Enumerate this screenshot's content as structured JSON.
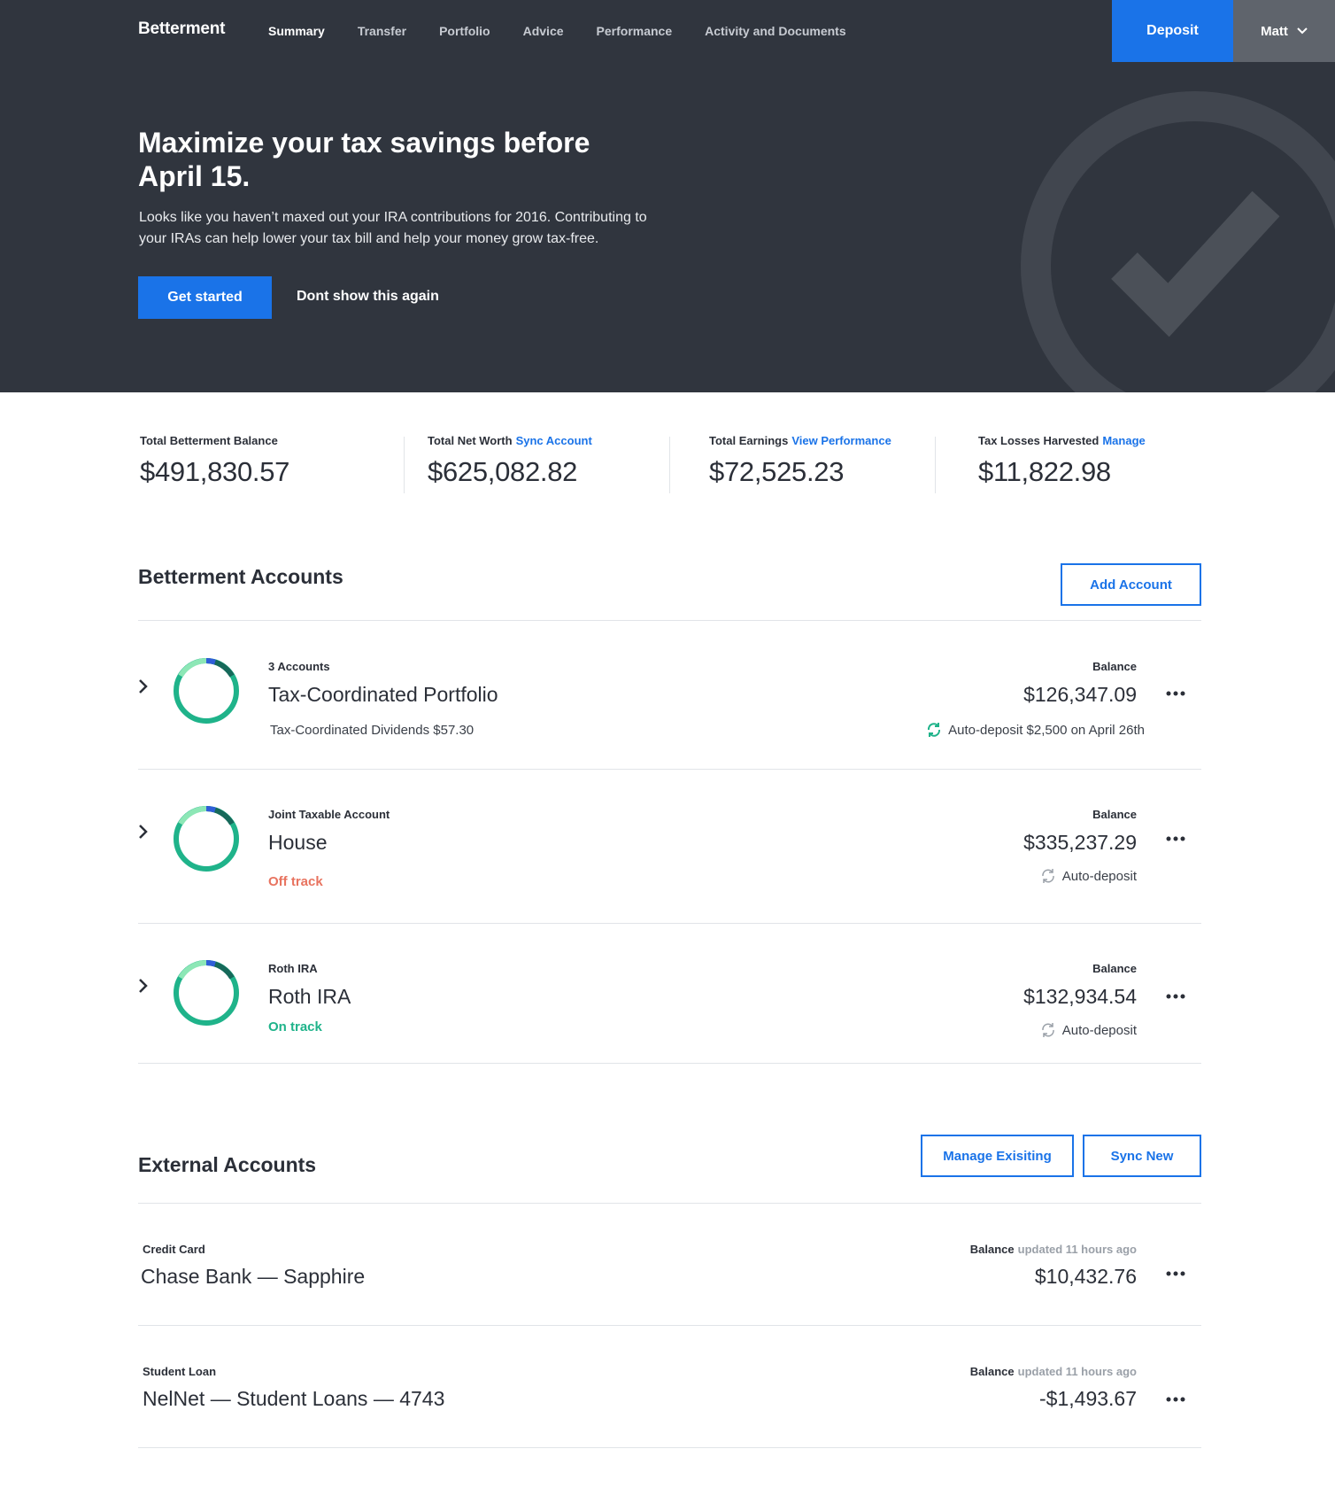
{
  "nav": {
    "brand": "Betterment",
    "links": [
      "Summary",
      "Transfer",
      "Portfolio",
      "Advice",
      "Performance",
      "Activity and Documents"
    ],
    "deposit_label": "Deposit",
    "user_name": "Matt"
  },
  "hero": {
    "title": "Maximize your tax savings before April 15.",
    "body": "Looks like you haven’t maxed out your IRA contributions for 2016. Contributing to your IRAs can help lower your tax bill and help your money grow tax-free.",
    "cta_label": "Get started",
    "dismiss_label": "Dont show this again"
  },
  "stats": [
    {
      "label": "Total Betterment Balance",
      "link": "",
      "value": "$491,830.57"
    },
    {
      "label": "Total Net Worth",
      "link": "Sync Account",
      "value": "$625,082.82"
    },
    {
      "label": "Total Earnings",
      "link": "View Performance",
      "value": "$72,525.23"
    },
    {
      "label": "Tax Losses Harvested",
      "link": "Manage",
      "value": "$11,822.98"
    }
  ],
  "betterment_accounts": {
    "title": "Betterment Accounts",
    "add_label": "Add Account",
    "items": [
      {
        "type": "3 Accounts",
        "name": "Tax-Coordinated Portfolio",
        "sub": "Tax-Coordinated Dividends $57.30",
        "balance_label": "Balance",
        "balance": "$126,347.09",
        "autodeposit": "Auto-deposit $2,500 on April 26th"
      },
      {
        "type": "Joint Taxable Account",
        "name": "House",
        "sub": "Off track",
        "balance_label": "Balance",
        "balance": "$335,237.29",
        "autodeposit": "Auto-deposit"
      },
      {
        "type": "Roth IRA",
        "name": "Roth IRA",
        "sub": "On track",
        "balance_label": "Balance",
        "balance": "$132,934.54",
        "autodeposit": "Auto-deposit"
      }
    ]
  },
  "external_accounts": {
    "title": "External Accounts",
    "manage_label": "Manage Exisiting",
    "sync_label": "Sync New",
    "items": [
      {
        "type": "Credit Card",
        "name": "Chase Bank — Sapphire",
        "balance_label": "Balance",
        "updated": "updated 11 hours ago",
        "balance": "$10,432.76"
      },
      {
        "type": "Student Loan",
        "name": "NelNet — Student Loans — 4743",
        "balance_label": "Balance",
        "updated": "updated 11 hours ago",
        "balance": "-$1,493.67"
      }
    ]
  },
  "colors": {
    "nav_bg": "#30353e",
    "accent": "#1a73e8",
    "off_track": "#e8735f",
    "on_track": "#1fb38a"
  }
}
